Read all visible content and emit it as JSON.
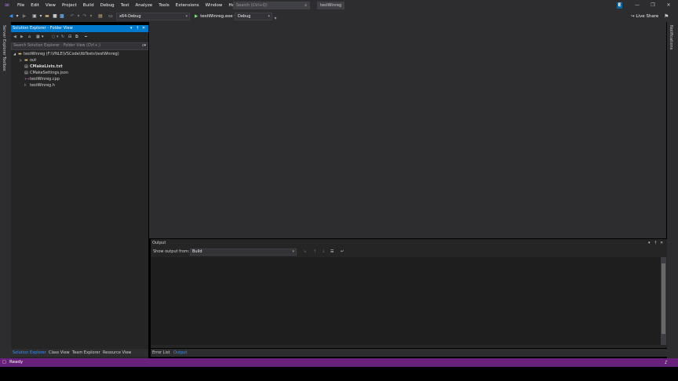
{
  "menu": [
    "File",
    "Edit",
    "View",
    "Project",
    "Build",
    "Debug",
    "Test",
    "Analyze",
    "Tools",
    "Extensions",
    "Window",
    "Help"
  ],
  "search": {
    "placeholder": "Search (Ctrl+Q)"
  },
  "solution_name": "testWinreg",
  "account_initial": "E",
  "toolbar": {
    "config": "x64-Debug",
    "run_target": "testWinreg.exe",
    "run_config": "Debug",
    "live_share": "Live Share"
  },
  "left_rail": {
    "server_explorer": "Server Explorer",
    "toolbox": "Toolbox"
  },
  "right_rail": {
    "notifications": "Notifications"
  },
  "solution_explorer": {
    "title": "Solution Explorer - Folder View",
    "search_placeholder": "Search Solution Explorer - Folder View (Ctrl+;)",
    "root": "testWinreg (F:\\VNLE\\VSCode\\libTests\\testWinreg)",
    "items": [
      {
        "label": "out",
        "type": "folder"
      },
      {
        "label": "CMakeLists.txt",
        "type": "cmake",
        "bold": true
      },
      {
        "label": "CMakeSettings.json",
        "type": "json"
      },
      {
        "label": "testWinreg.cpp",
        "type": "cpp"
      },
      {
        "label": "testWinreg.h",
        "type": "header"
      }
    ]
  },
  "left_bottom_tabs": [
    "Solution Explorer",
    "Class View",
    "Team Explorer",
    "Resource View"
  ],
  "output": {
    "title": "Output",
    "show_from_label": "Show output from:",
    "source": "Build"
  },
  "output_bottom_tabs": [
    "Error List",
    "Output"
  ],
  "status": {
    "text": "Ready"
  },
  "colors": {
    "accent": "#007acc",
    "status_bar": "#68217a",
    "active_tab_text": "#3794ff"
  }
}
